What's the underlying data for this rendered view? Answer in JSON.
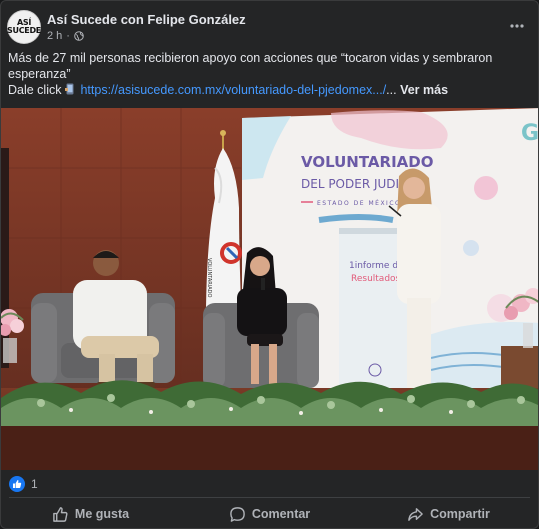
{
  "post": {
    "page_name": "Así Sucede con Felipe González",
    "time": "2 h",
    "dot": "·",
    "avatar_line1": "ASÍ",
    "avatar_line2": "SUCEDE",
    "text_main": "Más de 27 mil personas recibieron apoyo con acciones que “tocaron vidas y sembraron esperanza”",
    "text_click": "Dale click",
    "link": "https://asisucede.com.mx/voluntariado-del-pjedomex.../",
    "ellipsis": "...",
    "see_more": "Ver más"
  },
  "photo": {
    "banner_line1": "VOLUNTARIADO",
    "banner_line2": "DEL PODER JUDICIAL",
    "banner_line3": "ESTADO DE MÉXICO",
    "podium_line1": "1informe de",
    "podium_line2": "Resultados",
    "flag_text": "VOLUNTARIADO"
  },
  "reactions": {
    "count": "1"
  },
  "actions": {
    "like": "Me gusta",
    "comment": "Comentar",
    "share": "Compartir"
  },
  "colors": {
    "link": "#4599ff",
    "like_blue": "#1877f2",
    "background": "#242526"
  }
}
